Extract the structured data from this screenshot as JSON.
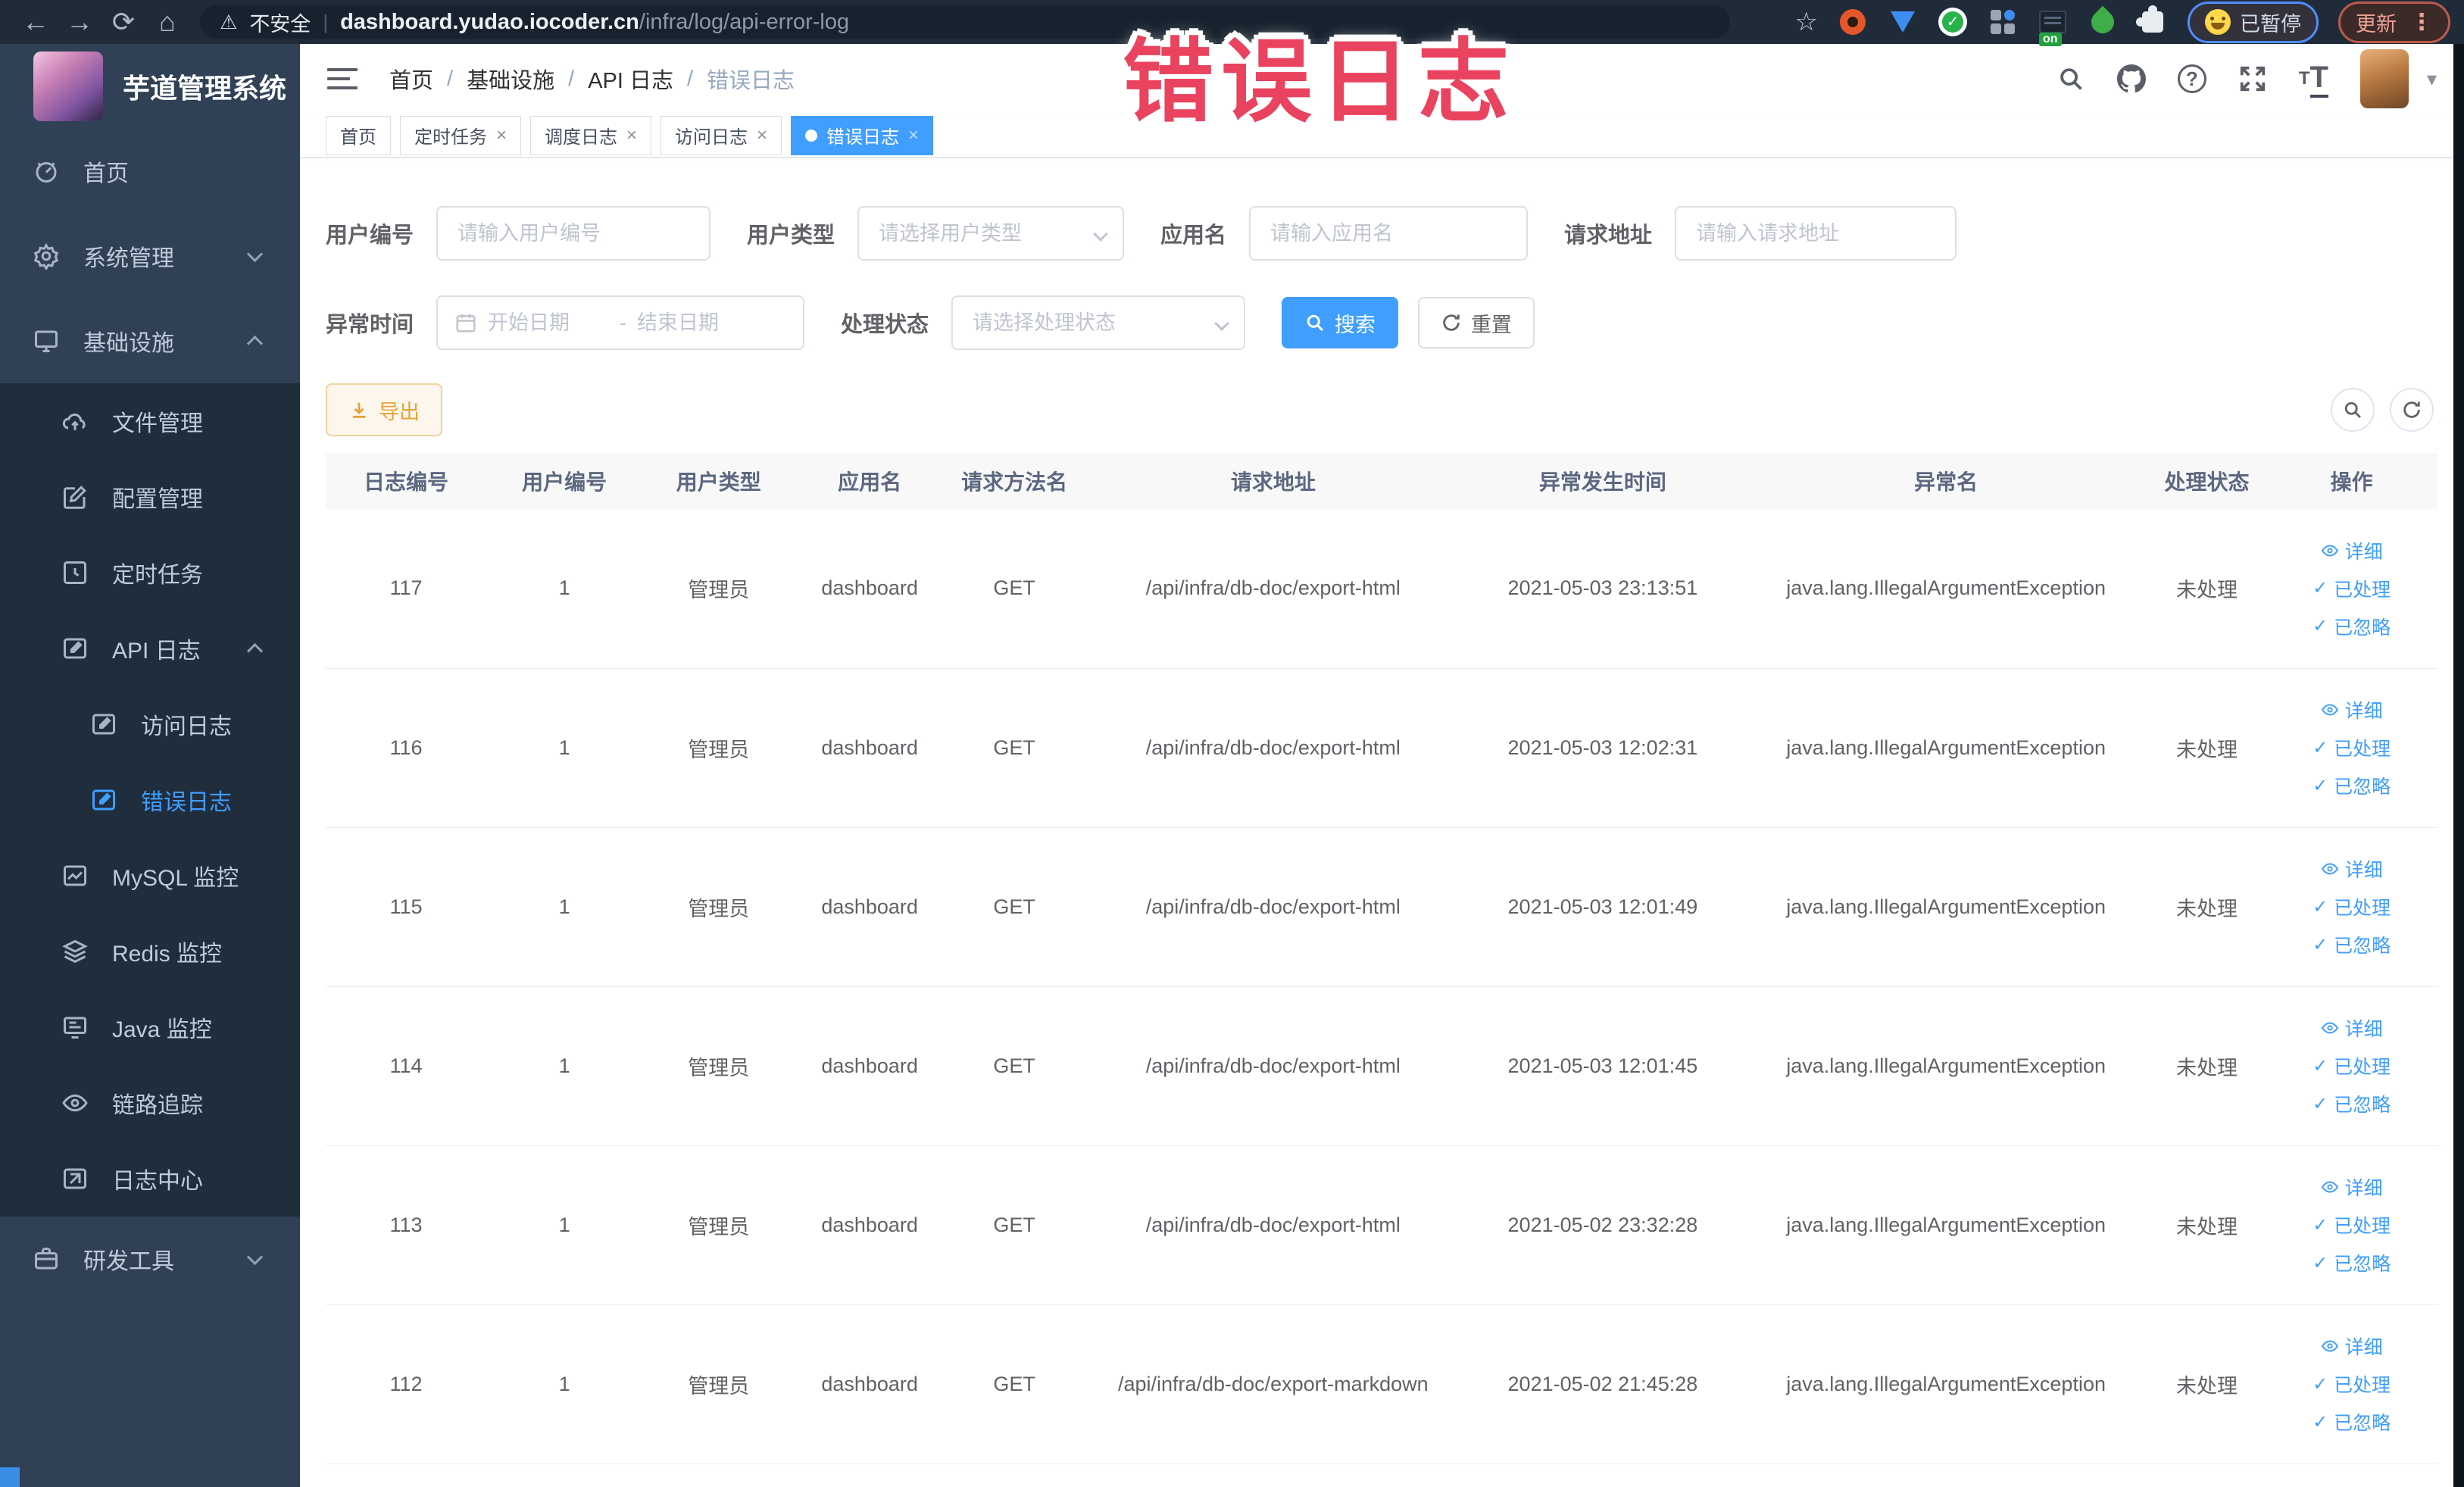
{
  "overlay": {
    "text": "错误日志"
  },
  "browser": {
    "security": "不安全",
    "divider": "|",
    "domain": "dashboard.yudao.iocoder.cn",
    "path": "/infra/log/api-error-log",
    "on_badge": "on",
    "paused_label": "已暂停",
    "update_label": "更新",
    "menu_dots": "⋮",
    "back": "←",
    "forward": "→",
    "reload": "⟳",
    "home": "⌂",
    "star": "☆",
    "warn": "⚠"
  },
  "sidebar": {
    "title": "芋道管理系统",
    "home": "首页",
    "system": "系统管理",
    "infra": "基础设施",
    "file": "文件管理",
    "config": "配置管理",
    "job": "定时任务",
    "api_log": "API 日志",
    "access_log": "访问日志",
    "error_log": "错误日志",
    "mysql": "MySQL 监控",
    "redis": "Redis 监控",
    "java": "Java 监控",
    "trace": "链路追踪",
    "log_center": "日志中心",
    "dev_tools": "研发工具"
  },
  "breadcrumb": {
    "items": [
      "首页",
      "基础设施",
      "API 日志",
      "错误日志"
    ],
    "separator": "/"
  },
  "tabs": [
    {
      "label": "首页"
    },
    {
      "label": "定时任务"
    },
    {
      "label": "调度日志"
    },
    {
      "label": "访问日志"
    },
    {
      "label": "错误日志"
    }
  ],
  "ui": {
    "close": "×",
    "caret": "▾",
    "range_separator": "-",
    "question": "?",
    "t_small": "T",
    "t_big": "T"
  },
  "filters": {
    "user_id_label": "用户编号",
    "user_id_placeholder": "请输入用户编号",
    "user_type_label": "用户类型",
    "user_type_placeholder": "请选择用户类型",
    "app_name_label": "应用名",
    "app_name_placeholder": "请输入应用名",
    "request_url_label": "请求地址",
    "request_url_placeholder": "请输入请求地址",
    "exception_time_label": "异常时间",
    "start_date_placeholder": "开始日期",
    "end_date_placeholder": "结束日期",
    "process_status_label": "处理状态",
    "process_status_placeholder": "请选择处理状态",
    "search_label": "搜索",
    "reset_label": "重置"
  },
  "toolbar": {
    "export_label": "导出"
  },
  "table": {
    "headers": [
      "日志编号",
      "用户编号",
      "用户类型",
      "应用名",
      "请求方法名",
      "请求地址",
      "异常发生时间",
      "异常名",
      "处理状态",
      "操作"
    ],
    "actions": [
      "详细",
      "已处理",
      "已忽略"
    ],
    "rows": [
      {
        "id": "117",
        "user_id": "1",
        "user_type": "管理员",
        "app_name": "dashboard",
        "method": "GET",
        "url": "/api/infra/db-doc/export-html",
        "time": "2021-05-03 23:13:51",
        "exception": "java.lang.IllegalArgumentException",
        "status": "未处理"
      },
      {
        "id": "116",
        "user_id": "1",
        "user_type": "管理员",
        "app_name": "dashboard",
        "method": "GET",
        "url": "/api/infra/db-doc/export-html",
        "time": "2021-05-03 12:02:31",
        "exception": "java.lang.IllegalArgumentException",
        "status": "未处理"
      },
      {
        "id": "115",
        "user_id": "1",
        "user_type": "管理员",
        "app_name": "dashboard",
        "method": "GET",
        "url": "/api/infra/db-doc/export-html",
        "time": "2021-05-03 12:01:49",
        "exception": "java.lang.IllegalArgumentException",
        "status": "未处理"
      },
      {
        "id": "114",
        "user_id": "1",
        "user_type": "管理员",
        "app_name": "dashboard",
        "method": "GET",
        "url": "/api/infra/db-doc/export-html",
        "time": "2021-05-03 12:01:45",
        "exception": "java.lang.IllegalArgumentException",
        "status": "未处理"
      },
      {
        "id": "113",
        "user_id": "1",
        "user_type": "管理员",
        "app_name": "dashboard",
        "method": "GET",
        "url": "/api/infra/db-doc/export-html",
        "time": "2021-05-02 23:32:28",
        "exception": "java.lang.IllegalArgumentException",
        "status": "未处理"
      },
      {
        "id": "112",
        "user_id": "1",
        "user_type": "管理员",
        "app_name": "dashboard",
        "method": "GET",
        "url": "/api/infra/db-doc/export-markdown",
        "time": "2021-05-02 21:45:28",
        "exception": "java.lang.IllegalArgumentException",
        "status": "未处理"
      }
    ]
  },
  "colors": {
    "accent": "#409eff",
    "export_text": "#e6a23c",
    "overlay_red": "#e9435f",
    "sidebar_bg": "#304156",
    "submenu_bg": "#1f2d3d"
  }
}
